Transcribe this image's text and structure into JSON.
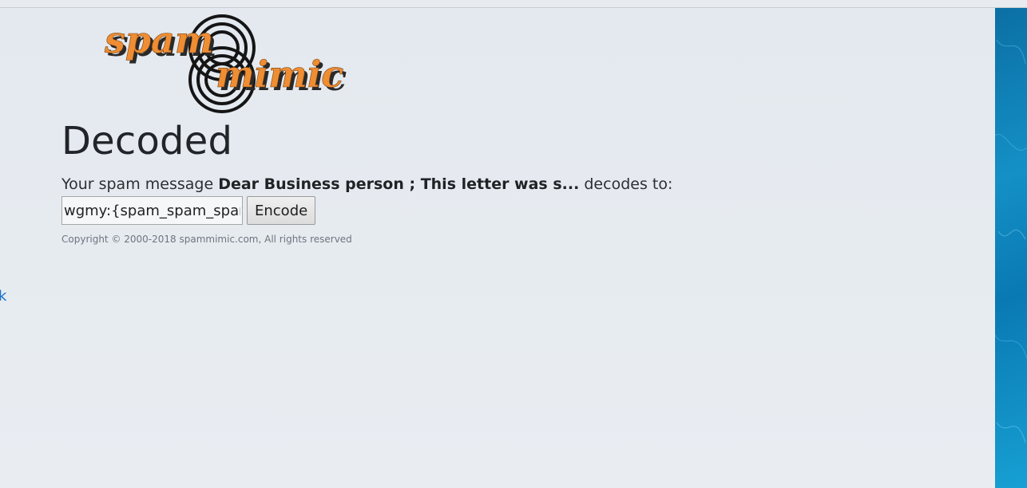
{
  "logo": {
    "text_top": "spam",
    "text_bottom": "mimic",
    "colors": {
      "fill": "#ef8d33",
      "shadow": "#2a2a2a",
      "rings": "#151515"
    }
  },
  "page": {
    "title": "Decoded"
  },
  "message": {
    "prefix": "Your spam message",
    "preview": "Dear Business person ; This letter was s...",
    "suffix": "decodes to:"
  },
  "decoded": {
    "value": "wgmy:{spam_spam_spam"
  },
  "actions": {
    "encode_label": "Encode"
  },
  "footer": {
    "copyright": "Copyright © 2000-2018 spammimic.com, All rights reserved"
  },
  "edge_link": {
    "label": "k"
  },
  "colors": {
    "page_bg": "#e6ebf0",
    "side_panel": "#0e82bd",
    "link": "#1a73c9",
    "title": "#212529"
  }
}
